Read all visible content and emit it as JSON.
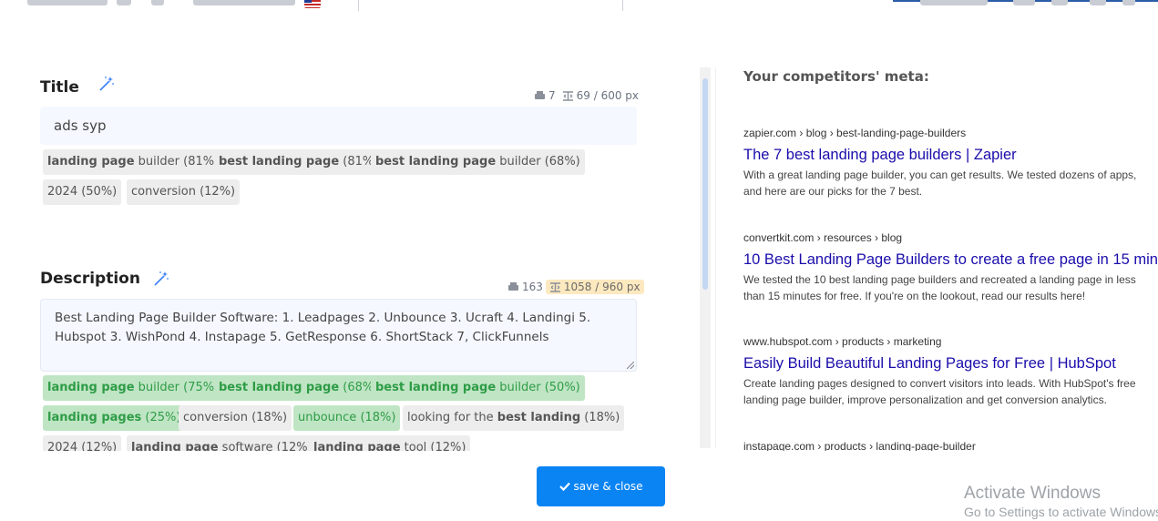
{
  "colors": {
    "link": "#1a0dab",
    "primary": "#0b84f3",
    "keyword_match": "#2e9c46",
    "keyword_match_bg": "#bfe5c4",
    "warning_bg": "#fde9bf"
  },
  "title_section": {
    "heading": "Title",
    "words": "7",
    "pixels": "69 / 600 px",
    "value": "ads syp",
    "keywords": [
      {
        "pre": "",
        "bold": "landing page",
        "post": " builder (81%)"
      },
      {
        "pre": "",
        "bold": "best landing page",
        "post": " (81%)"
      },
      {
        "pre": "",
        "bold": "best landing page",
        "post": " builder (68%)"
      },
      {
        "pre": "2024 (50%)",
        "bold": "",
        "post": ""
      },
      {
        "pre": "conversion (12%)",
        "bold": "",
        "post": ""
      }
    ]
  },
  "description_section": {
    "heading": "Description",
    "words": "163",
    "pixels": "1058 / 960 px",
    "value": "Best Landing Page Builder Software: 1. Leadpages 2. Unbounce 3. Ucraft 4. Landingi 5. Hubspot 3. WishPond 4. Instapage 5. GetResponse 6. ShortStack 7, ClickFunnels",
    "keywords": [
      {
        "pre": "",
        "bold": "landing page",
        "post": " builder (75%)"
      },
      {
        "pre": "",
        "bold": "best landing page",
        "post": " (68%)"
      },
      {
        "pre": "",
        "bold": "best landing page",
        "post": " builder (50%)"
      },
      {
        "pre": "",
        "bold": "landing pages",
        "post": " (25%)"
      },
      {
        "pre": "conversion (18%)",
        "bold": "",
        "post": ""
      },
      {
        "pre": "unbounce (18%)",
        "bold": "",
        "post": ""
      },
      {
        "pre": "looking for the ",
        "bold": "best landing",
        "post": " (18%)"
      },
      {
        "pre": "2024 (12%)",
        "bold": "",
        "post": ""
      },
      {
        "pre": "",
        "bold": "landing page",
        "post": " software (12%)"
      },
      {
        "pre": "",
        "bold": "landing page",
        "post": " tool (12%)"
      }
    ]
  },
  "competitors": {
    "heading": "Your competitors' meta:",
    "results": [
      {
        "url": "zapier.com › blog › best-landing-page-builders",
        "title": "The 7 best landing page builders | Zapier",
        "snippet": "With a great landing page builder, you can get results. We tested dozens of apps, and here are our picks for the 7 best."
      },
      {
        "url": "convertkit.com › resources › blog",
        "title": "10 Best Landing Page Builders to create a free page in 15 min",
        "snippet": "We tested the 10 best landing page builders and recreated a landing page in less than 15 minutes for free. If you're on the lookout, read our results here!"
      },
      {
        "url": "www.hubspot.com › products › marketing",
        "title": "Easily Build Beautiful Landing Pages for Free | HubSpot",
        "snippet": "Create landing pages designed to convert visitors into leads. With HubSpot's free landing page builder, improve personalization and get conversion analytics."
      },
      {
        "url": "instapage.com › products › landing-page-builder",
        "title": "",
        "snippet": ""
      }
    ]
  },
  "save_button": "save & close",
  "watermark": {
    "line1": "Activate Windows",
    "line2": "Go to Settings to activate Windows."
  }
}
